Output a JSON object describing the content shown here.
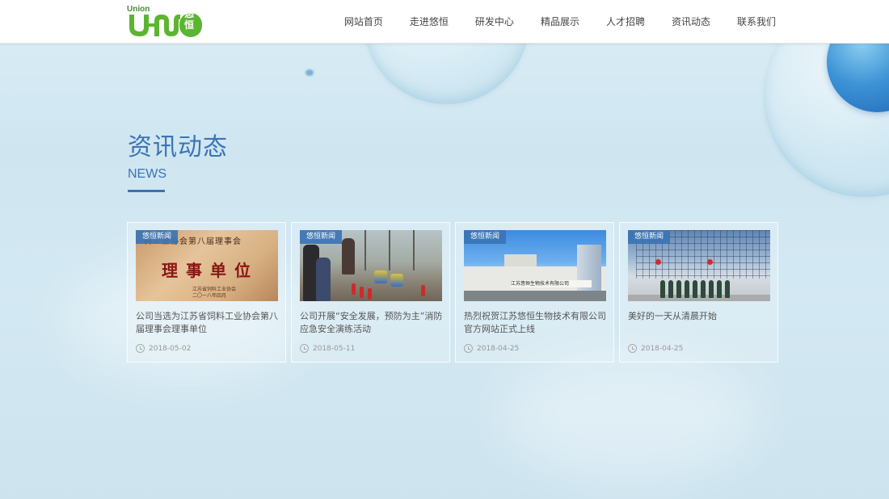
{
  "logo": {
    "union_text": "Union",
    "cn_text": "悠恒"
  },
  "nav": [
    {
      "label": "网站首页"
    },
    {
      "label": "走进悠恒"
    },
    {
      "label": "研发中心"
    },
    {
      "label": "精品展示"
    },
    {
      "label": "人才招聘"
    },
    {
      "label": "资讯动态"
    },
    {
      "label": "联系我们"
    }
  ],
  "section": {
    "title_cn": "资讯动态",
    "title_en": "NEWS"
  },
  "news": [
    {
      "tag": "悠恒新闻",
      "title": "公司当选为江苏省饲料工业协会第八届理事会理事单位",
      "date": "2018-05-02",
      "image_text": {
        "top": "料工业协会第八届理事会",
        "main": "理事单位",
        "sub1": "江苏省饲料工业协会",
        "sub2": "二〇一八年四月"
      }
    },
    {
      "tag": "悠恒新闻",
      "title": "公司开展“安全发展，预防为主”消防应急安全演练活动",
      "date": "2018-05-11"
    },
    {
      "tag": "悠恒新闻",
      "title": "热烈祝贺江苏悠恒生物技术有限公司官方网站正式上线",
      "date": "2018-04-25",
      "image_text": {
        "sign": "江苏悠恒生物技术有限公司"
      }
    },
    {
      "tag": "悠恒新闻",
      "title": "美好的一天从清晨开始",
      "date": "2018-04-25"
    }
  ],
  "colors": {
    "brand_blue": "#3b74b4",
    "logo_green": "#5cb531"
  }
}
